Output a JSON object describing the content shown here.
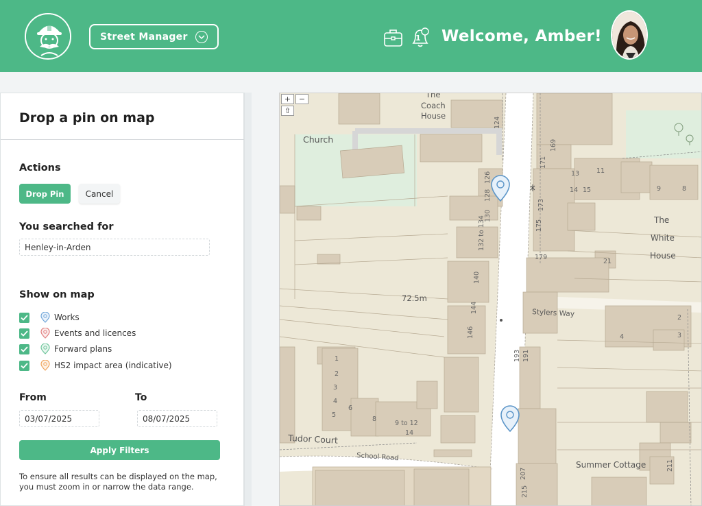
{
  "header": {
    "app_selector": {
      "label": "Street Manager",
      "icon": "chevron-down-icon"
    },
    "icons": [
      "briefcase-icon",
      "bell-icon"
    ],
    "notification_count": "1",
    "welcome": "Welcome, Amber!",
    "colors": {
      "brand": "#4db887"
    }
  },
  "panel": {
    "title": "Drop a pin on map",
    "actions": {
      "heading": "Actions",
      "drop_pin": "Drop Pin",
      "cancel": "Cancel"
    },
    "search": {
      "heading": "You searched for",
      "value": "Henley-in-Arden"
    },
    "layers": {
      "heading": "Show on map",
      "items": [
        {
          "label": "Works",
          "checked": true,
          "pin_color": "#6ea5d8"
        },
        {
          "label": "Events and licences",
          "checked": true,
          "pin_color": "#e07a7a"
        },
        {
          "label": "Forward plans",
          "checked": true,
          "pin_color": "#6cc49a"
        },
        {
          "label": "HS2 impact area (indicative)",
          "checked": true,
          "pin_color": "#f0a25a"
        }
      ]
    },
    "dates": {
      "from_label": "From",
      "from_value": "03/07/2025",
      "to_label": "To",
      "to_value": "08/07/2025"
    },
    "apply": "Apply Filters",
    "note": "To ensure all results can be displayed on the map, you must zoom in or narrow the data range."
  },
  "map": {
    "controls": {
      "zoom_in": "+",
      "zoom_out": "−",
      "up": "⇧"
    },
    "labels": {
      "the": "The",
      "coach_house_1": "Coach",
      "coach_house_2": "House",
      "church": "Church",
      "elevation": "72.5m",
      "the_white_house_1": "The",
      "the_white_house_2": "White",
      "the_white_house_3": "House",
      "stylers_way": "Stylers Way",
      "tudor_court": "Tudor Court",
      "school_road": "School Road",
      "summer_cottage": "Summer Cottage"
    },
    "numbers": [
      "124",
      "126",
      "128",
      "130",
      "132 to 134",
      "140",
      "144",
      "146",
      "169",
      "171",
      "173",
      "175",
      "179",
      "13",
      "11",
      "15",
      "14",
      "9",
      "8",
      "21",
      "2",
      "4",
      "3",
      "191",
      "193",
      "1",
      "2",
      "3",
      "4",
      "5",
      "6",
      "8",
      "9 to 12",
      "14",
      "207",
      "211",
      "215"
    ],
    "pins": [
      "map-pin-1",
      "map-pin-2"
    ]
  }
}
